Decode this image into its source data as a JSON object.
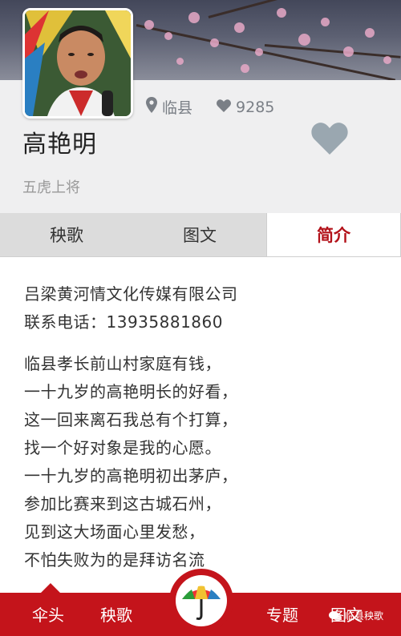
{
  "profile": {
    "location": "临县",
    "likes": "9285",
    "name": "高艳明",
    "subtitle": "五虎上将"
  },
  "tabs": [
    {
      "label": "秧歌",
      "active": false
    },
    {
      "label": "图文",
      "active": false
    },
    {
      "label": "简介",
      "active": true
    }
  ],
  "content": {
    "company": "吕梁黄河情文化传媒有限公司",
    "phone": "联系电话：13935881860",
    "lyrics": [
      "临县孝长前山村家庭有钱，",
      "一十九岁的高艳明长的好看，",
      "这一回来离石我总有个打算，",
      "找一个好对象是我的心愿。",
      "一十九岁的高艳明初出茅庐，",
      "参加比赛来到这古城石州，",
      "见到这大场面心里发愁，",
      "不怕失败为的是拜访名流"
    ]
  },
  "bottom_nav": {
    "items": [
      "伞头",
      "秧歌",
      "专题",
      "图文"
    ],
    "watermark": "临县秧歌"
  },
  "colors": {
    "brand_red": "#c4141b",
    "active_tab_text": "#b3121a",
    "heart_gray": "#9aa7b0"
  }
}
